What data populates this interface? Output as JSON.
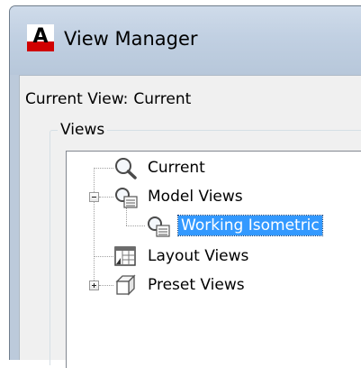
{
  "window": {
    "title": "View Manager",
    "app_icon_letter": "A"
  },
  "current_view": {
    "label": "Current View:",
    "value": "Current"
  },
  "views_group": {
    "label": "Views"
  },
  "tree": {
    "items": [
      {
        "label": "Current",
        "icon": "magnifier-icon"
      },
      {
        "label": "Model Views",
        "icon": "model-views-icon",
        "expanded": true
      },
      {
        "label": "Working Isometric",
        "icon": "named-view-icon",
        "selected": true
      },
      {
        "label": "Layout Views",
        "icon": "layout-views-icon"
      },
      {
        "label": "Preset Views",
        "icon": "preset-views-cube-icon",
        "expanded": false
      }
    ]
  },
  "colors": {
    "selection": "#3399ff",
    "app_icon_red": "#d00000",
    "titlebar": "#c1d0e2"
  }
}
